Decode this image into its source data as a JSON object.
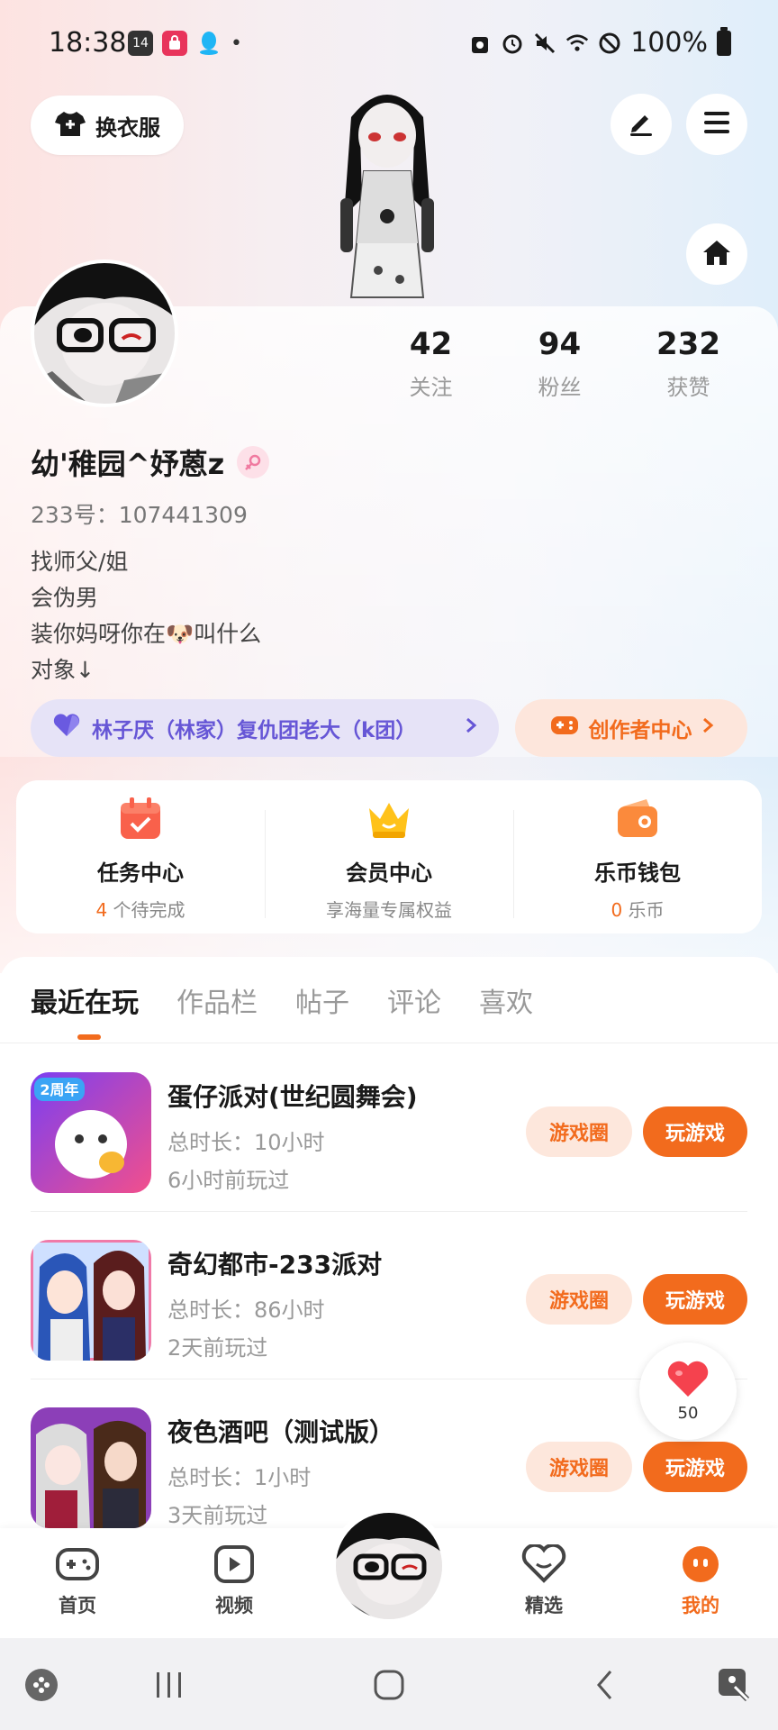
{
  "status_bar": {
    "time": "18:38",
    "battery": "100%"
  },
  "header": {
    "outfit_label": "换衣服"
  },
  "profile": {
    "stats": [
      {
        "value": "42",
        "label": "关注"
      },
      {
        "value": "94",
        "label": "粉丝"
      },
      {
        "value": "232",
        "label": "获赞"
      }
    ],
    "username": "幼'稚园^妤蒽z",
    "uid": "233号：107441309",
    "bio": [
      "找师父/姐",
      "会伪男",
      "装你妈呀你在🐶叫什么",
      "对象↓"
    ],
    "guild": "林子厌（林家）复仇团老大（k团）",
    "creator_center": "创作者中心"
  },
  "features": [
    {
      "title": "任务中心",
      "sub_prefix": "4",
      "sub_suffix": " 个待完成"
    },
    {
      "title": "会员中心",
      "sub_prefix": "",
      "sub_suffix": "享海量专属权益"
    },
    {
      "title": "乐币钱包",
      "sub_prefix": "0",
      "sub_suffix": " 乐币"
    }
  ],
  "tabs": [
    "最近在玩",
    "作品栏",
    "帖子",
    "评论",
    "喜欢"
  ],
  "games": [
    {
      "name": "蛋仔派对(世纪圆舞会)",
      "duration": "总时长：10小时",
      "last_played": "6小时前玩过",
      "circle_btn": "游戏圈",
      "play_btn": "玩游戏",
      "thumb_badge": "2周年"
    },
    {
      "name": "奇幻都市-233派对",
      "duration": "总时长：86小时",
      "last_played": "2天前玩过",
      "circle_btn": "游戏圈",
      "play_btn": "玩游戏"
    },
    {
      "name": "夜色酒吧（测试版）",
      "duration": "总时长：1小时",
      "last_played": "3天前玩过",
      "circle_btn": "游戏圈",
      "play_btn": "玩游戏"
    }
  ],
  "float_like": {
    "count": "50"
  },
  "bottom_nav": [
    {
      "label": "首页"
    },
    {
      "label": "视频"
    },
    {
      "label": "精选"
    },
    {
      "label": "我的"
    }
  ],
  "colors": {
    "accent": "#f26b1d",
    "guild": "#6656d6"
  }
}
